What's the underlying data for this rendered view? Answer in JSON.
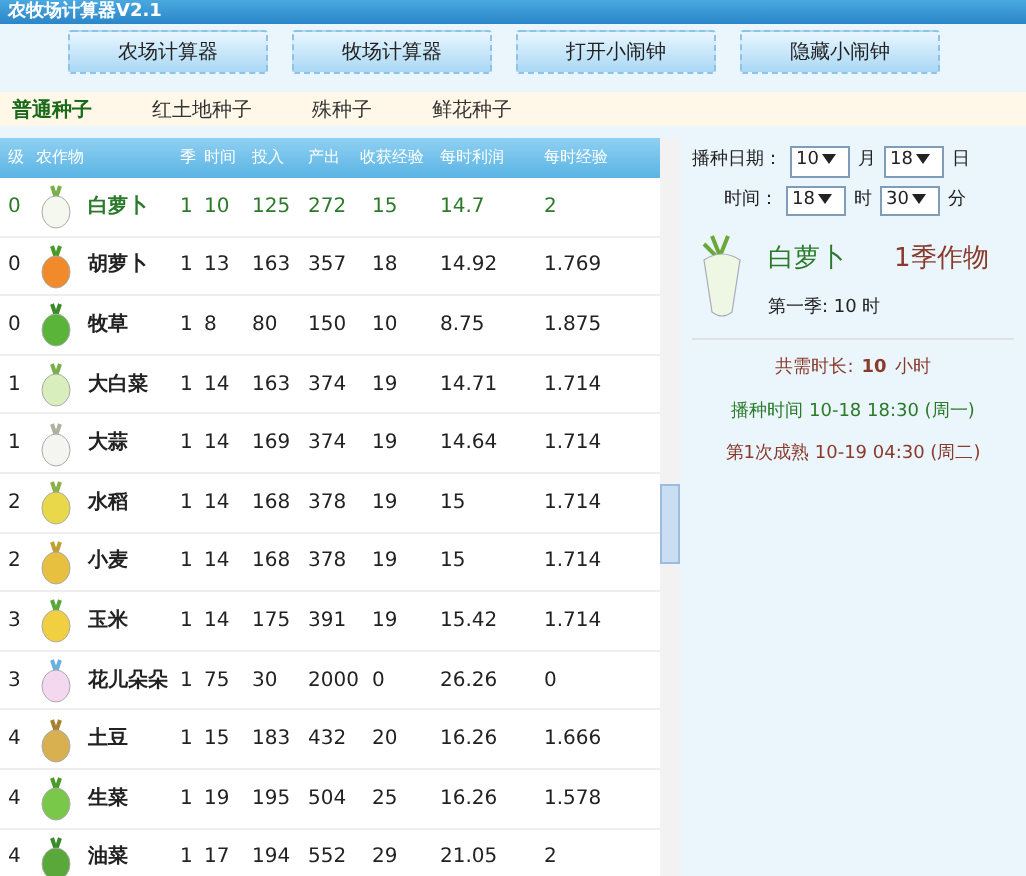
{
  "window": {
    "title": "农牧场计算器V2.1"
  },
  "toolbar_buttons": [
    "农场计算器",
    "牧场计算器",
    "打开小闹钟",
    "隐藏小闹钟"
  ],
  "seed_tabs": [
    {
      "label": "普通种子",
      "selected": true
    },
    {
      "label": "红土地种子",
      "selected": false
    },
    {
      "label": "殊种子",
      "selected": false
    },
    {
      "label": "鲜花种子",
      "selected": false
    }
  ],
  "table": {
    "columns": [
      "级",
      "农作物",
      "季",
      "时间",
      "投入",
      "产出",
      "收获经验",
      "每时利润",
      "每时经验"
    ],
    "rows": [
      {
        "level": "0",
        "name": "白萝卜",
        "season": "1",
        "hours": "10",
        "cost": "125",
        "income": "272",
        "exp": "15",
        "profit_per_hour": "14.7",
        "exp_per_hour": "2",
        "selected": true
      },
      {
        "level": "0",
        "name": "胡萝卜",
        "season": "1",
        "hours": "13",
        "cost": "163",
        "income": "357",
        "exp": "18",
        "profit_per_hour": "14.92",
        "exp_per_hour": "1.769",
        "selected": false
      },
      {
        "level": "0",
        "name": "牧草",
        "season": "1",
        "hours": "8",
        "cost": "80",
        "income": "150",
        "exp": "10",
        "profit_per_hour": "8.75",
        "exp_per_hour": "1.875",
        "selected": false
      },
      {
        "level": "1",
        "name": "大白菜",
        "season": "1",
        "hours": "14",
        "cost": "163",
        "income": "374",
        "exp": "19",
        "profit_per_hour": "14.71",
        "exp_per_hour": "1.714",
        "selected": false
      },
      {
        "level": "1",
        "name": "大蒜",
        "season": "1",
        "hours": "14",
        "cost": "169",
        "income": "374",
        "exp": "19",
        "profit_per_hour": "14.64",
        "exp_per_hour": "1.714",
        "selected": false
      },
      {
        "level": "2",
        "name": "水稻",
        "season": "1",
        "hours": "14",
        "cost": "168",
        "income": "378",
        "exp": "19",
        "profit_per_hour": "15",
        "exp_per_hour": "1.714",
        "selected": false
      },
      {
        "level": "2",
        "name": "小麦",
        "season": "1",
        "hours": "14",
        "cost": "168",
        "income": "378",
        "exp": "19",
        "profit_per_hour": "15",
        "exp_per_hour": "1.714",
        "selected": false
      },
      {
        "level": "3",
        "name": "玉米",
        "season": "1",
        "hours": "14",
        "cost": "175",
        "income": "391",
        "exp": "19",
        "profit_per_hour": "15.42",
        "exp_per_hour": "1.714",
        "selected": false
      },
      {
        "level": "3",
        "name": "花儿朵朵",
        "season": "1",
        "hours": "75",
        "cost": "30",
        "income": "2000",
        "exp": "0",
        "profit_per_hour": "26.26",
        "exp_per_hour": "0",
        "selected": false
      },
      {
        "level": "4",
        "name": "土豆",
        "season": "1",
        "hours": "15",
        "cost": "183",
        "income": "432",
        "exp": "20",
        "profit_per_hour": "16.26",
        "exp_per_hour": "1.666",
        "selected": false
      },
      {
        "level": "4",
        "name": "生菜",
        "season": "1",
        "hours": "19",
        "cost": "195",
        "income": "504",
        "exp": "25",
        "profit_per_hour": "16.26",
        "exp_per_hour": "1.578",
        "selected": false
      },
      {
        "level": "4",
        "name": "油菜",
        "season": "1",
        "hours": "17",
        "cost": "194",
        "income": "552",
        "exp": "29",
        "profit_per_hour": "21.05",
        "exp_per_hour": "2",
        "selected": false
      }
    ]
  },
  "detail": {
    "date_label": "播种日期：",
    "month": "10",
    "month_unit": "月",
    "day": "18",
    "day_unit": "日",
    "time_label": "时间：",
    "hour": "18",
    "hour_unit": "时",
    "minute": "30",
    "minute_unit": "分",
    "crop_name": "白萝卜",
    "crop_type": "1季作物",
    "season_line": "第一季: 10 时",
    "total_label": "共需时长:",
    "total_value": "10",
    "total_unit": "小时",
    "sow_time": "播种时间 10-18 18:30 (周一)",
    "ripe_time": "第1次成熟 10-19 04:30 (周二)"
  }
}
